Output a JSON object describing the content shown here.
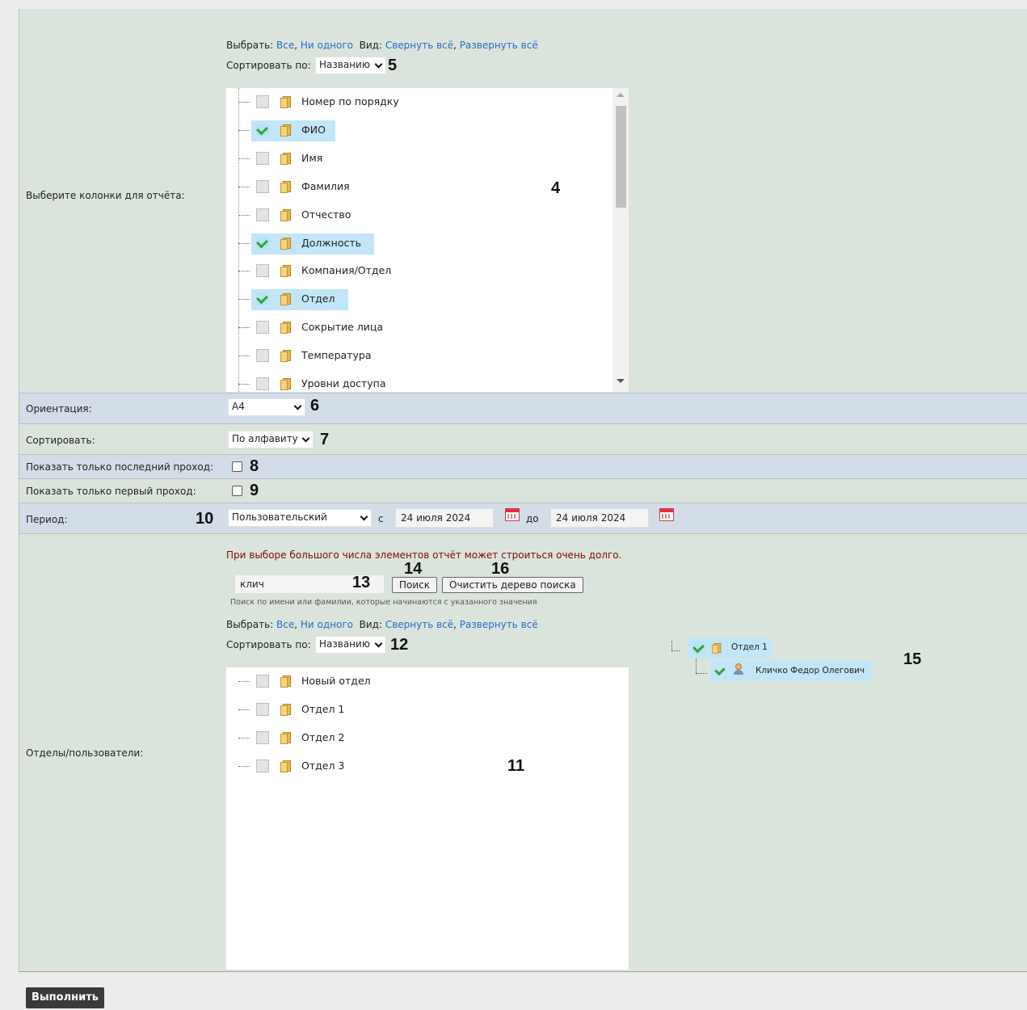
{
  "columns_section": {
    "label": "Выберите колонки для отчёта:",
    "select_label": "Выбрать:",
    "select_all": "Все",
    "select_none": "Ни одного",
    "view_label": "Вид:",
    "collapse_all": "Свернуть всё",
    "expand_all": "Развернуть всё",
    "sort_label": "Сортировать по:",
    "sort_value": "Названию",
    "items": [
      {
        "label": "Номер по порядку",
        "checked": false
      },
      {
        "label": "ФИО",
        "checked": true
      },
      {
        "label": "Имя",
        "checked": false
      },
      {
        "label": "Фамилия",
        "checked": false
      },
      {
        "label": "Отчество",
        "checked": false
      },
      {
        "label": "Должность",
        "checked": true
      },
      {
        "label": "Компания/Отдел",
        "checked": false
      },
      {
        "label": "Отдел",
        "checked": true
      },
      {
        "label": "Сокрытие лица",
        "checked": false
      },
      {
        "label": "Температура",
        "checked": false
      },
      {
        "label": "Уровни доступа",
        "checked": false
      }
    ]
  },
  "orientation": {
    "label": "Ориентация:",
    "value": "A4"
  },
  "sort": {
    "label": "Сортировать:",
    "value": "По алфавиту"
  },
  "last_pass": {
    "label": "Показать только последний проход:",
    "checked": false
  },
  "first_pass": {
    "label": "Показать только первый проход:",
    "checked": false
  },
  "period": {
    "label": "Период:",
    "value": "Пользовательский",
    "from_label": "с",
    "from_date": "24 июля 2024",
    "to_label": "до",
    "to_date": "24 июля 2024"
  },
  "departments": {
    "label": "Отделы/пользователи:",
    "warning": "При выборе большого числа элементов отчёт может строиться очень долго.",
    "search_value": "клич",
    "search_button": "Поиск",
    "clear_button": "Очистить дерево поиска",
    "search_hint": "Поиск по имени или фамилии, которые начинаются с указанного значения",
    "select_label": "Выбрать:",
    "select_all": "Все",
    "select_none": "Ни одного",
    "view_label": "Вид:",
    "collapse_all": "Свернуть всё",
    "expand_all": "Развернуть всё",
    "sort_label": "Сортировать по:",
    "sort_value": "Названию",
    "tree": [
      "Новый отдел",
      "Отдел 1",
      "Отдел 2",
      "Отдел 3"
    ],
    "search_tree": {
      "department": "Отдел 1",
      "user": "Кличко Федор Олегович"
    }
  },
  "run_button": "Выполнить",
  "callouts": {
    "n4": "4",
    "n5": "5",
    "n6": "6",
    "n7": "7",
    "n8": "8",
    "n9": "9",
    "n10": "10",
    "n11": "11",
    "n12": "12",
    "n13": "13",
    "n14": "14",
    "n15": "15",
    "n16": "16"
  },
  "colors": {
    "link": "#2a6ac8",
    "warning": "#7a0a0a",
    "row_blue": "#d3dde8",
    "row_green": "#dbe4dc",
    "check_green": "#2fa82f",
    "highlight": "#c2e6f7"
  }
}
